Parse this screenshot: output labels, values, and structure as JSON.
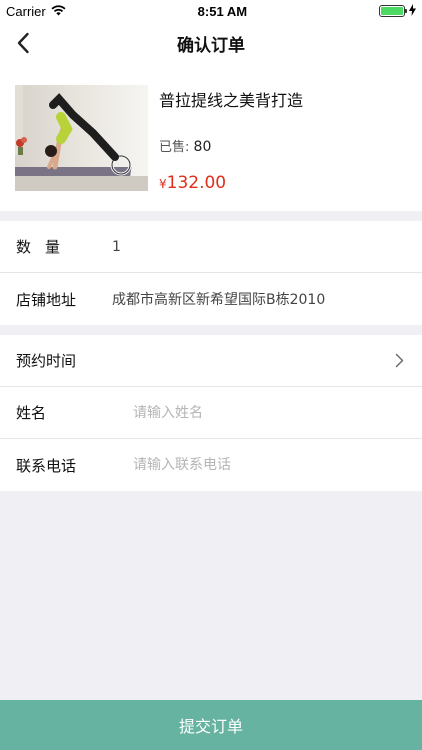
{
  "status": {
    "carrier": "Carrier",
    "time": "8:51 AM",
    "battery_level": 1.0
  },
  "nav": {
    "title": "确认订单"
  },
  "product": {
    "name": "普拉提线之美背打造",
    "sold_label": "已售:",
    "sold_count": "80",
    "currency": "¥",
    "price": "132.00"
  },
  "info": {
    "quantity_label": "数量",
    "quantity_value": "1",
    "address_label": "店铺地址",
    "address_value": "成都市高新区新希望国际B栋2010"
  },
  "booking": {
    "time_label": "预约时间",
    "name_label": "姓名",
    "name_placeholder": "请输入姓名",
    "phone_label": "联系电话",
    "phone_placeholder": "请输入联系电话"
  },
  "submit_label": "提交订单"
}
